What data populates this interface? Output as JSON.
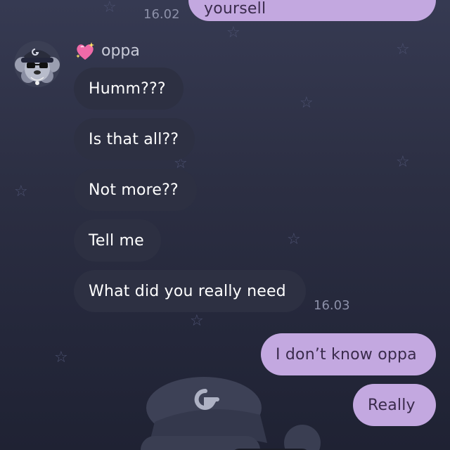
{
  "chat": {
    "top_partial_message": {
      "text": "yoursell",
      "time": "16.02"
    },
    "sender": {
      "name": "oppa"
    },
    "incoming": [
      {
        "text": "Humm???"
      },
      {
        "text": "Is that all??"
      },
      {
        "text": "Not more??"
      },
      {
        "text": "Tell me"
      },
      {
        "text": "What did you really need"
      }
    ],
    "incoming_time": "16.03",
    "outgoing": [
      {
        "text": "I don’t know oppa"
      },
      {
        "text": "Really"
      }
    ]
  },
  "colors": {
    "incoming_bubble": "#2d3042",
    "outgoing_bubble": "#c3a8e0",
    "background": "#2c2f43"
  }
}
